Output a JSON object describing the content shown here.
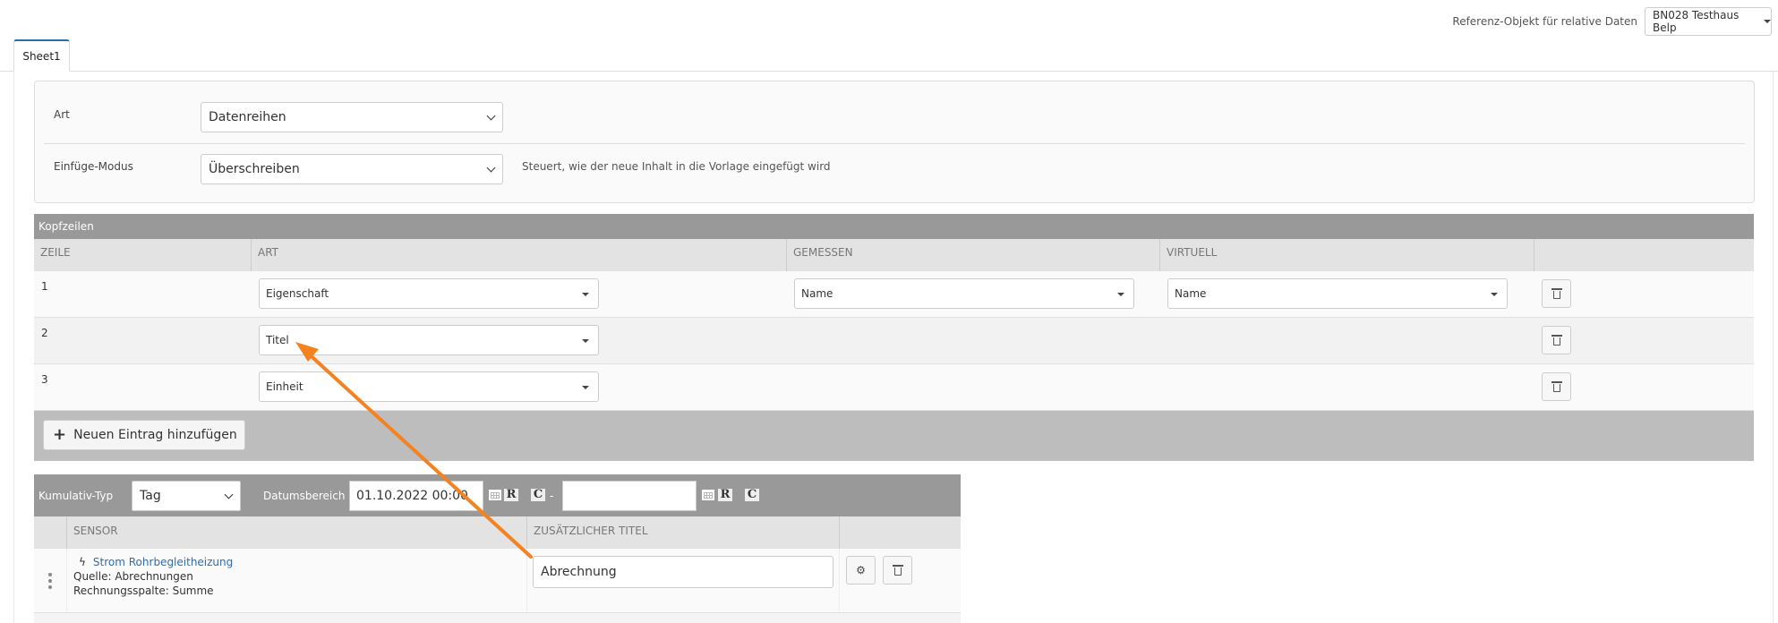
{
  "header": {
    "reference_label": "Referenz-Objekt für relative Daten",
    "reference_value": "BN028 Testhaus Belp"
  },
  "tabs": [
    {
      "label": "Sheet1"
    }
  ],
  "settings": {
    "art_label": "Art",
    "art_value": "Datenreihen",
    "mode_label": "Einfüge-Modus",
    "mode_value": "Überschreiben",
    "mode_hint": "Steuert, wie der neue Inhalt in die Vorlage eingefügt wird"
  },
  "kopfzeilen": {
    "title": "Kopfzeilen",
    "columns": [
      "Zeile",
      "Art",
      "Gemessen",
      "Virtuell",
      ""
    ],
    "rows": [
      {
        "zeile": "1",
        "art": "Eigenschaft",
        "gemessen": "Name",
        "virtuell": "Name"
      },
      {
        "zeile": "2",
        "art": "Titel",
        "gemessen": "",
        "virtuell": ""
      },
      {
        "zeile": "3",
        "art": "Einheit",
        "gemessen": "",
        "virtuell": ""
      }
    ],
    "add_label": "Neuen Eintrag hinzufügen"
  },
  "lower": {
    "kumulativ_label": "Kumulativ-Typ",
    "kumulativ_value": "Tag",
    "datumsbereich_label": "Datumsbereich",
    "date_from": "01.10.2022 00:00",
    "date_to": "",
    "date_separator": "-",
    "icons": {
      "calendar": "calendar-icon",
      "relative": "R",
      "clear": "C"
    },
    "columns": [
      "",
      "Sensor",
      "Zusätzlicher Titel",
      ""
    ],
    "rows": [
      {
        "sensor_name": "Strom Rohrbegleitheizung",
        "quelle": "Quelle: Abrechnungen",
        "rechnungsspalte": "Rechnungsspalte: Summe",
        "titel": "Abrechnung"
      }
    ]
  },
  "colors": {
    "accent": "#2a6fb2",
    "header_gray": "#999999",
    "annotation": "#f58220"
  }
}
